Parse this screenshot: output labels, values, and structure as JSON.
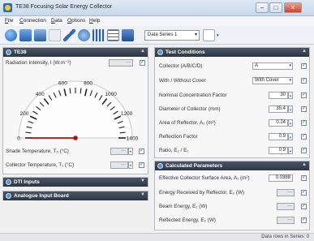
{
  "window": {
    "title": "TE38 Focusing Solar Energy Collector"
  },
  "menu": [
    {
      "key": "F",
      "rest": "ile"
    },
    {
      "key": "C",
      "rest": "onnection"
    },
    {
      "key": "D",
      "rest": "ata"
    },
    {
      "key": "O",
      "rest": "ptions"
    },
    {
      "key": "H",
      "rest": "elp"
    }
  ],
  "toolbar": {
    "series_select": "Data Series 1"
  },
  "te38": {
    "header": "TE38",
    "gauge_label": "Radiation Intensity, I  (W.m⁻²)",
    "gauge": {
      "min": 0,
      "max": 1400,
      "value": 0,
      "ticks": [
        "0",
        "200",
        "400",
        "600",
        "800",
        "1000",
        "1200",
        "1400"
      ]
    },
    "shade_label": "Shade Temperature, T₂  (°C)",
    "collector_label": "Collector Temperature, T₁  (°C)"
  },
  "dti": {
    "header": "DTI Inputs"
  },
  "analogue": {
    "header": "Analogue Input Board"
  },
  "test": {
    "header": "Test Conditions",
    "collector_label": "Collector (A/B/C/D)",
    "collector_value": "A",
    "cover_label": "With / Without Cover",
    "cover_value": "With Cover",
    "ncf_label": "Nominal Concentration Factor",
    "ncf_value": "30",
    "diameter_label": "Diameter of Collector  (mm)",
    "diameter_value": "35.4",
    "area_label": "Area of Reflector, A₁  (m²)",
    "area_value": "0.24",
    "reflection_label": "Reflection Factor",
    "reflection_value": "0.9",
    "ratio_label": "Ratio, E₂ / E₁",
    "ratio_value": "0.9"
  },
  "calc": {
    "header": "Calculated Parameters",
    "effective_label": "Effective Collector Surface Area, A₁  (m²)",
    "effective_value": "0.0388",
    "energy_reflector_label": "Energy Received by Reflector, E₂  (W)",
    "beam_label": "Beam Energy, E₁  (W)",
    "reflected_label": "Reflected Energy, E₂  (W)",
    "placeholder": "---"
  },
  "status": {
    "text": "Data rows in Series: 0"
  }
}
